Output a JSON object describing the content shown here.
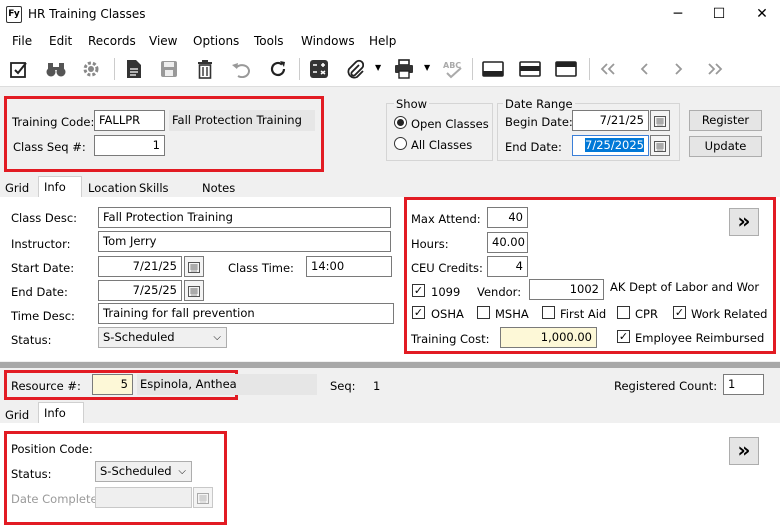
{
  "window": {
    "title": "HR Training Classes",
    "minimize": "─",
    "maximize": "☐",
    "close": "✕"
  },
  "menu": [
    "File",
    "Edit",
    "Records",
    "View",
    "Options",
    "Tools",
    "Windows",
    "Help"
  ],
  "toolbar": {
    "icons": [
      "edit-check-icon",
      "binoculars-icon",
      "gear-icon",
      "document-icon",
      "save-icon",
      "delete-icon",
      "undo-icon",
      "refresh-icon",
      "calculator-icon",
      "paperclip-icon",
      "print-icon",
      "spellcheck-icon",
      "layout-1-icon",
      "layout-2-icon",
      "layout-3-icon",
      "first-record-icon",
      "prev-record-icon",
      "next-record-icon",
      "last-record-icon"
    ]
  },
  "header": {
    "training_code_label": "Training Code:",
    "training_code": "FALLPR",
    "training_name": "Fall Protection Training",
    "class_seq_label": "Class Seq #:",
    "class_seq": "1",
    "show_label": "Show",
    "open_classes": "Open Classes",
    "all_classes": "All Classes",
    "date_range_label": "Date Range",
    "begin_date_label": "Begin Date:",
    "begin_date": "7/21/25",
    "end_date_label": "End Date:",
    "end_date": "7/25/2025",
    "register": "Register",
    "update": "Update"
  },
  "tabs1": [
    "Grid",
    "Info",
    "Location",
    "Skills",
    "Notes"
  ],
  "class_info": {
    "class_desc_label": "Class Desc:",
    "class_desc": "Fall Protection Training",
    "instructor_label": "Instructor:",
    "instructor": "Tom Jerry",
    "start_date_label": "Start Date:",
    "start_date": "7/21/25",
    "class_time_label": "Class Time:",
    "class_time": "14:00",
    "end_date_label": "End Date:",
    "end_date": "7/25/25",
    "time_desc_label": "Time Desc:",
    "time_desc": "Training for fall prevention",
    "status_label": "Status:",
    "status": "S-Scheduled"
  },
  "attend": {
    "max_attend_label": "Max Attend:",
    "max_attend": "40",
    "hours_label": "Hours:",
    "hours": "40.00",
    "ceu_label": "CEU Credits:",
    "ceu": "4",
    "c1099": "1099",
    "vendor_label": "Vendor:",
    "vendor": "1002",
    "vendor_name": "AK Dept of Labor and Work...",
    "osha": "OSHA",
    "msha": "MSHA",
    "first_aid": "First Aid",
    "cpr": "CPR",
    "work_related": "Work Related",
    "training_cost_label": "Training Cost:",
    "training_cost": "1,000.00",
    "employee_reimbursed": "Employee Reimbursed",
    "expand": "»"
  },
  "resource": {
    "resource_label": "Resource #:",
    "resource_num": "5",
    "resource_name": "Espinola, Anthea",
    "seq_label": "Seq:",
    "seq": "1",
    "registered_count_label": "Registered Count:",
    "registered_count": "1"
  },
  "tabs2": [
    "Grid",
    "Info"
  ],
  "position": {
    "position_code_label": "Position Code:",
    "status_label": "Status:",
    "status": "S-Scheduled",
    "date_complete_label": "Date Complete:",
    "expand": "»"
  }
}
